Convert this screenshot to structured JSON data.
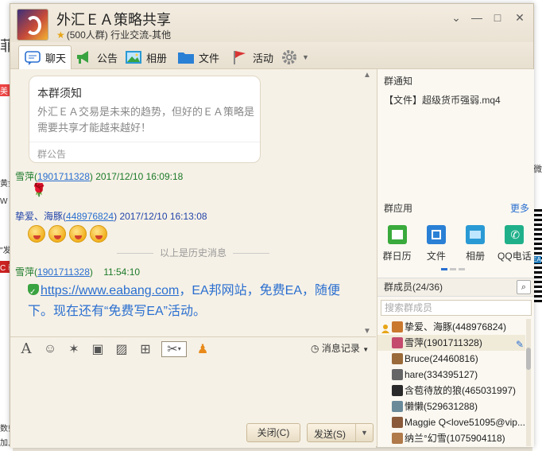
{
  "background": {
    "left_fragments": [
      "菲",
      "美",
      "黄金",
      "W",
      "\"发",
      "C 教",
      "数师",
      "加入"
    ],
    "right_fragments": [
      "微",
      "EA"
    ]
  },
  "window": {
    "group_name": "外汇ＥＡ策略共享",
    "group_meta": "(500人群) 行业交流-其他",
    "controls": {
      "dropdown": "⌄",
      "minimize": "—",
      "maximize": "□",
      "close": "✕"
    }
  },
  "tabs": [
    {
      "label": "聊天",
      "icon": "chat-icon"
    },
    {
      "label": "公告",
      "icon": "megaphone-icon"
    },
    {
      "label": "相册",
      "icon": "photo-icon"
    },
    {
      "label": "文件",
      "icon": "folder-icon"
    },
    {
      "label": "活动",
      "icon": "flag-icon"
    }
  ],
  "notice_card": {
    "title": "本群须知",
    "body": "外汇ＥＡ交易是未来的趋势，但好的ＥＡ策略是需要共享才能越来越好！",
    "footer": "群公告"
  },
  "messages": [
    {
      "sender": "雪萍",
      "qq": "1901711328",
      "time": "2017/12/10 16:09:18"
    },
    {
      "sender": "挚爱、海豚",
      "qq": "448976824",
      "time": "2017/12/10 16:13:08"
    },
    {
      "sender": "雪萍",
      "qq": "1901711328",
      "time": "11:54:10"
    }
  ],
  "history_divider": "以上是历史消息",
  "latest_message": {
    "link": "https://www.eabang.com",
    "text": "，EA邦网站，免费EA，随便下。现在还有“免费写EA”活动。"
  },
  "input_bar": {
    "history_label": "消息记录",
    "close_label": "关闭(C)",
    "send_label": "发送(S)"
  },
  "right_panel": {
    "notice_title": "群通知",
    "notice_file": "【文件】超级货币强弱.mq4",
    "apps_title": "群应用",
    "more_label": "更多",
    "apps": [
      {
        "label": "群日历",
        "color": "#3aaa3c"
      },
      {
        "label": "文件",
        "color": "#2a80d5"
      },
      {
        "label": "相册",
        "color": "#2a9ad5"
      },
      {
        "label": "QQ电话",
        "color": "#1fb08a"
      }
    ],
    "members_title": "群成员(24/36)",
    "search_placeholder": "搜索群成员",
    "members": [
      {
        "name": "挚爱、海豚(448976824)",
        "role": "owner",
        "color": "#c9782e"
      },
      {
        "name": "雪萍(1901711328)",
        "role": "",
        "color": "#c44a6e"
      },
      {
        "name": "Bruce(24460816)",
        "role": "",
        "color": "#9a6a3a"
      },
      {
        "name": "hare(334395127)",
        "role": "",
        "color": "#666"
      },
      {
        "name": "含苞待放的狼(465031997)",
        "role": "",
        "color": "#2a2a2a"
      },
      {
        "name": "懒懒(529631288)",
        "role": "",
        "color": "#6a8a9a"
      },
      {
        "name": "Maggie Q<love51095@vip....",
        "role": "",
        "color": "#8a5a3a"
      },
      {
        "name": "纳兰°幻雪(1075904118)",
        "role": "",
        "color": "#b07a4a"
      }
    ]
  }
}
